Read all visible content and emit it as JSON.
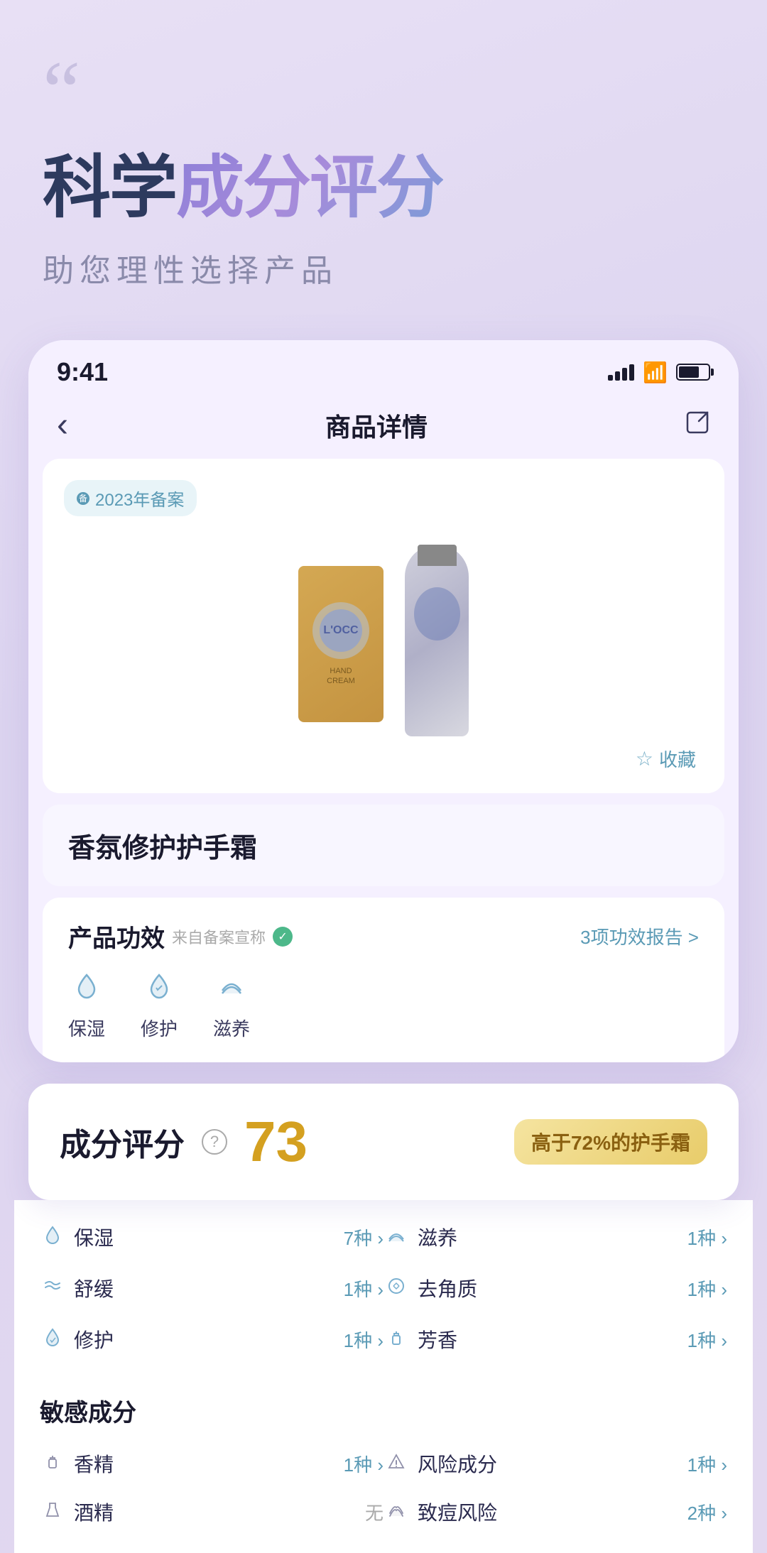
{
  "header": {
    "quote": "“",
    "title_dark": "科学",
    "title_purple": "成分评分",
    "subtitle": "助您理性选择产品"
  },
  "statusBar": {
    "time": "9:41",
    "signal": "signal",
    "wifi": "wifi",
    "battery": "battery"
  },
  "navBar": {
    "back": "‹",
    "title": "商品详情",
    "share": "⬡"
  },
  "product": {
    "badge": "备 2023年备案",
    "name": "香氛修护护手霜",
    "collect": "收藏"
  },
  "effects": {
    "title": "产品功效",
    "source": "来自备案宣称",
    "link": "3项功效报告 >",
    "items": [
      {
        "icon": "💧",
        "label": "保湿"
      },
      {
        "icon": "💧",
        "label": "修护"
      },
      {
        "icon": "🌊",
        "label": "滋养"
      }
    ]
  },
  "score": {
    "title": "成分评分",
    "value": "73",
    "badge": "高于72%的护手霜"
  },
  "ingredientCategories": [
    {
      "icon": "💧",
      "name": "保湿",
      "count": "7种 ›"
    },
    {
      "icon": "🌊",
      "name": "滋养",
      "count": "1种 ›"
    },
    {
      "icon": "〰",
      "name": "舒缓",
      "count": "1种 ›"
    },
    {
      "icon": "🔄",
      "name": "去角质",
      "count": "1种 ›"
    },
    {
      "icon": "💧",
      "name": "修护",
      "count": "1种 ›"
    },
    {
      "icon": "🧴",
      "name": "芳香",
      "count": "1种 ›"
    }
  ],
  "sensitiveTitle": "敏感成分",
  "sensitiveItems": [
    {
      "icon": "🧴",
      "name": "香精",
      "count": "1种 ›"
    },
    {
      "icon": "△",
      "name": "风险成分",
      "count": "1种 ›"
    },
    {
      "icon": "🍷",
      "name": "酒精",
      "value": "无"
    },
    {
      "icon": "〰",
      "name": "致痘风险",
      "count": "2种 ›"
    }
  ]
}
